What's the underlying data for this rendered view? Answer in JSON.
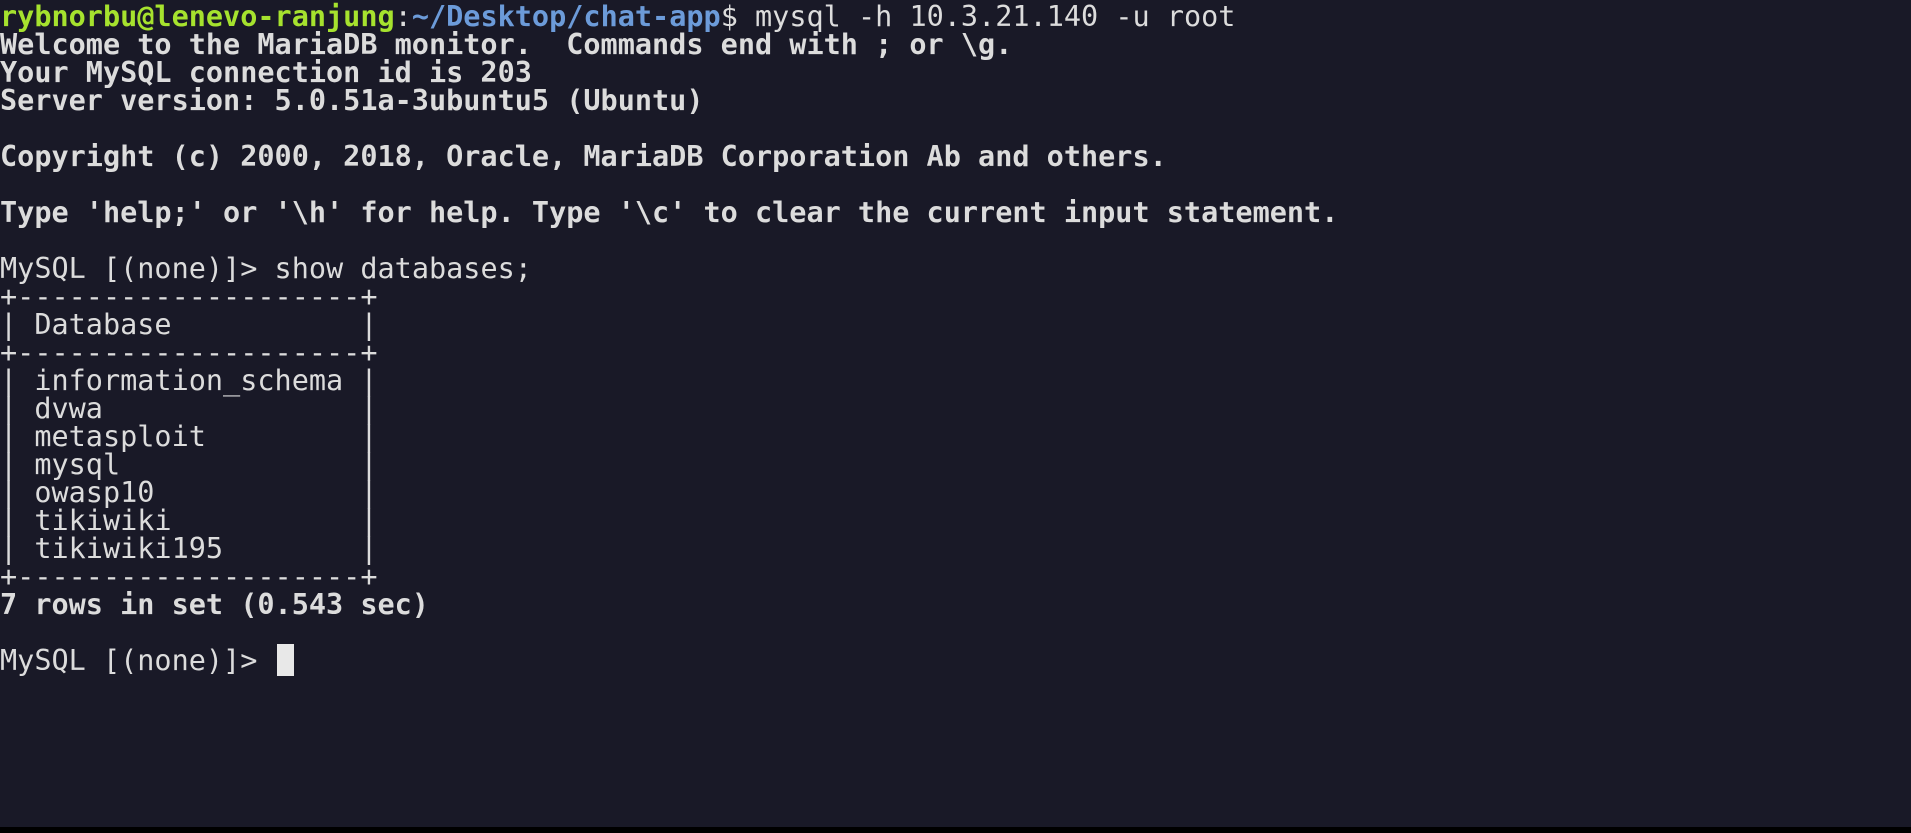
{
  "prompt": {
    "user_host": "rybnorbu@lenevo-ranjung",
    "separator": ":",
    "path": "~/Desktop/chat-app",
    "dollar": "$",
    "command": " mysql -h 10.3.21.140 -u root"
  },
  "output": {
    "welcome": "Welcome to the MariaDB monitor.  Commands end with ; or \\g.",
    "connection_id": "Your MySQL connection id is 203",
    "server_version": "Server version: 5.0.51a-3ubuntu5 (Ubuntu)",
    "copyright": "Copyright (c) 2000, 2018, Oracle, MariaDB Corporation Ab and others.",
    "help": "Type 'help;' or '\\h' for help. Type '\\c' to clear the current input statement."
  },
  "mysql_prompt": "MySQL [(none)]>",
  "query": " show databases;",
  "table": {
    "border": "+--------------------+",
    "header": "| Database           |",
    "rows": [
      "| information_schema |",
      "| dvwa               |",
      "| metasploit         |",
      "| mysql              |",
      "| owasp10            |",
      "| tikiwiki           |",
      "| tikiwiki195        |"
    ]
  },
  "result_summary": "7 rows in set (0.543 sec)",
  "final_prompt": "MySQL [(none)]> "
}
